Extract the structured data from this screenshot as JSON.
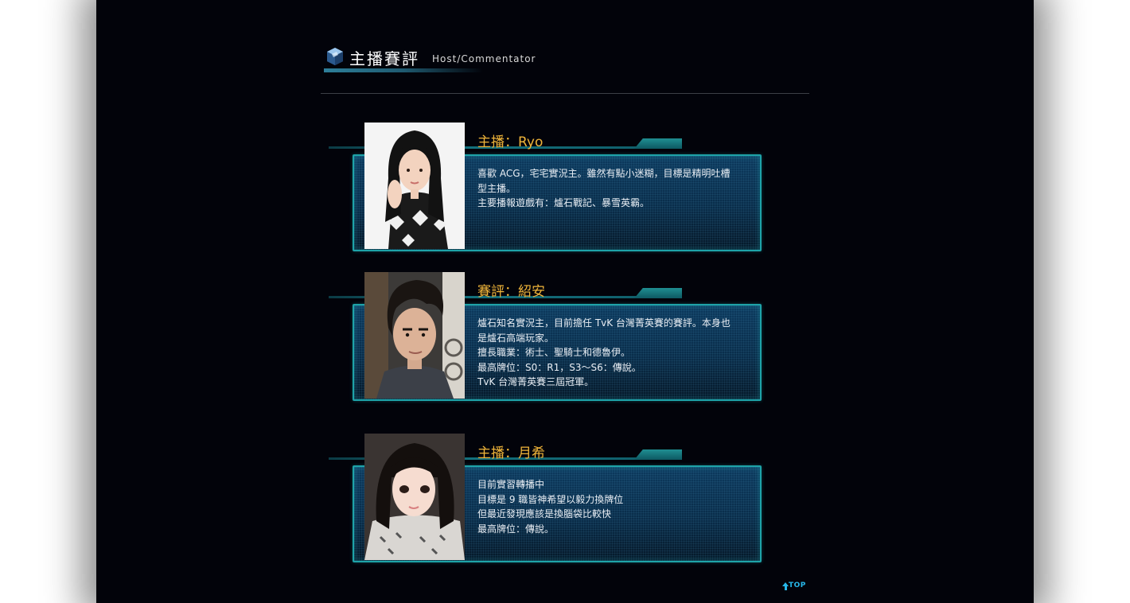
{
  "header": {
    "title": "主播賽評",
    "subtitle": "Host/Commentator"
  },
  "cards": [
    {
      "name": "主播：Ryo",
      "description": [
        "喜歡 ACG，宅宅實況主。雖然有點小迷糊，目標是精明吐槽",
        "型主播。",
        "主要播報遊戲有：爐石戰記、暴雪英霸。"
      ]
    },
    {
      "name": "賽評：紹安",
      "description": [
        "爐石知名實況主，目前擔任 TvK 台灣菁英賽的賽評。本身也",
        "是爐石高端玩家。",
        "擅長職業：術士、聖騎士和德魯伊。",
        "最高牌位：S0：R1，S3～S6：傳說。",
        "TvK 台灣菁英賽三屆冠軍。"
      ]
    },
    {
      "name": "主播：月希",
      "description": [
        "目前實習轉播中",
        "目標是 9 職皆神希望以毅力換牌位",
        "但最近發現應該是換腦袋比較快",
        "最高牌位：傳說。"
      ]
    }
  ],
  "footer": {
    "top_label": "TOP"
  },
  "colors": {
    "background": "#02030a",
    "accent": "#1ea3a8",
    "name": "#f0b53a",
    "top_link": "#27b7e9"
  }
}
